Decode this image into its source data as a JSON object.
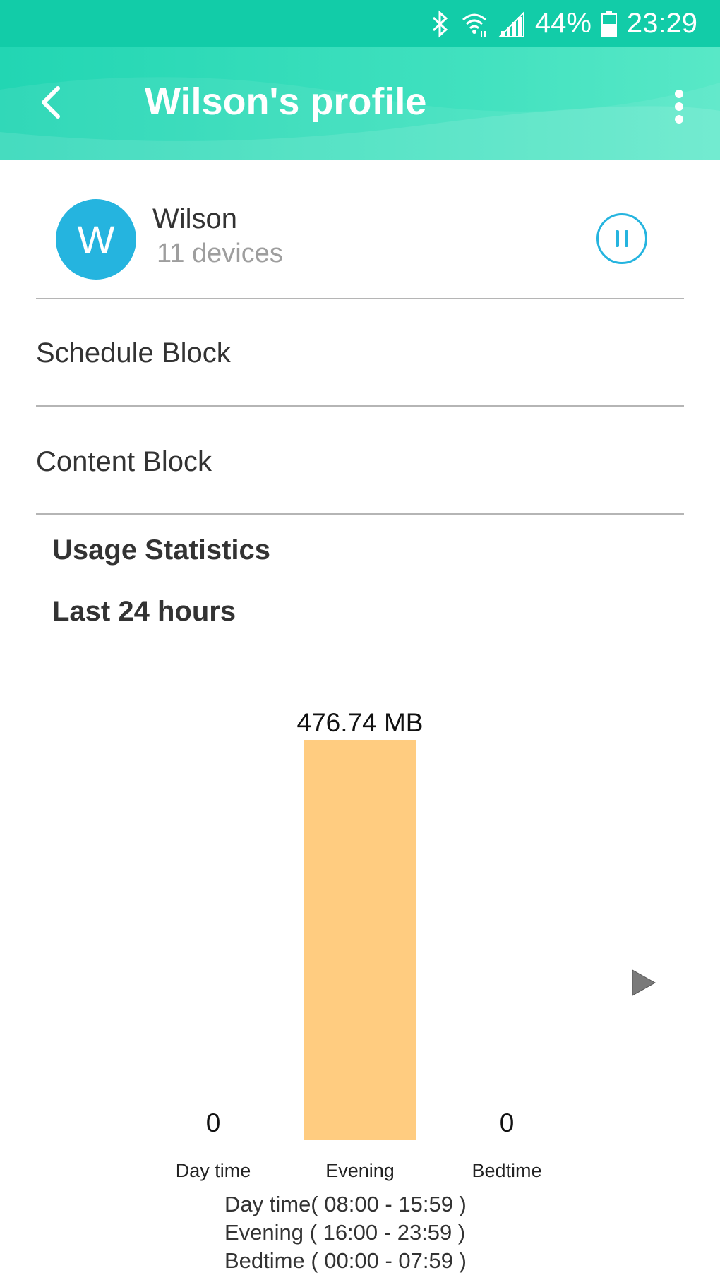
{
  "status_bar": {
    "battery_percent": "44%",
    "time": "23:29",
    "icons": [
      "bluetooth-icon",
      "wifi-icon",
      "signal-icon",
      "battery-icon"
    ]
  },
  "app_bar": {
    "title": "Wilson's profile",
    "back_icon": "chevron-left-icon",
    "more_icon": "more-vert-icon"
  },
  "profile": {
    "avatar_letter": "W",
    "name": "Wilson",
    "devices": "11 devices",
    "pause_icon": "pause-icon"
  },
  "menu": {
    "schedule_block": "Schedule Block",
    "content_block": "Content Block"
  },
  "usage": {
    "title": "Usage Statistics",
    "period": "Last 24 hours"
  },
  "chart_data": {
    "type": "bar",
    "categories": [
      "Day time",
      "Evening",
      "Bedtime"
    ],
    "values": [
      0,
      476.74
    ],
    "value_labels": [
      "0",
      "476.74 MB",
      "0"
    ],
    "bar_color": "#ffcc80",
    "unit": "MB",
    "legend": {
      "day": "Day time( 08:00 - 15:59 )",
      "evening": "Evening ( 16:00 - 23:59 )",
      "bedtime": "Bedtime ( 00:00 - 07:59 )"
    }
  },
  "colors": {
    "status_bar": "#12cca8",
    "app_bar": "#3ee0be",
    "accent_blue": "#25b4df",
    "bar": "#ffcc80"
  }
}
